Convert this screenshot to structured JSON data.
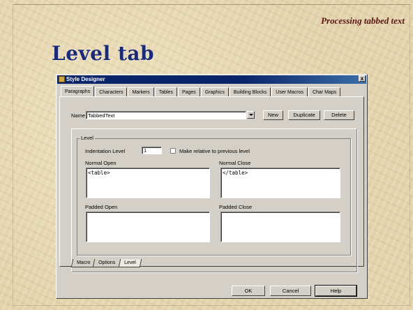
{
  "slide": {
    "subtitle": "Processing tabbed text",
    "title": "Level tab"
  },
  "dialog": {
    "title": "Style Designer",
    "close_label": "x",
    "top_tabs": [
      "Paragraphs",
      "Characters",
      "Markers",
      "Tables",
      "Pages",
      "Graphics",
      "Building Blocks",
      "User Macros",
      "Char Maps"
    ],
    "name_label": "Name",
    "name_value": "TabbedText",
    "new_label": "New",
    "duplicate_label": "Duplicate",
    "delete_label": "Delete",
    "level_group_label": "Level",
    "indent_label": "Indentation Level",
    "indent_value": "1",
    "make_relative_label": "Make relative to previous level",
    "normal_open_label": "Normal Open",
    "normal_open_value": "<table>",
    "normal_close_label": "Normal Close",
    "normal_close_value": "</table>",
    "padded_open_label": "Padded Open",
    "padded_open_value": "",
    "padded_close_label": "Padded Close",
    "padded_close_value": "",
    "bottom_tabs": [
      "Macro",
      "Options",
      "Level"
    ],
    "ok_label": "OK",
    "cancel_label": "Cancel",
    "help_label": "Help"
  }
}
